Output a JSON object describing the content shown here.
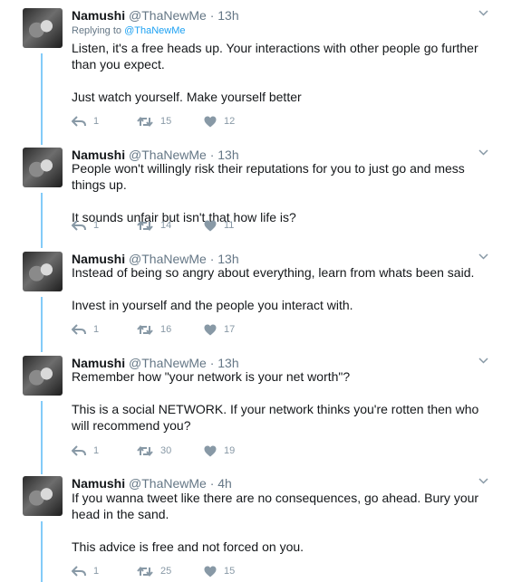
{
  "tweets": [
    {
      "name": "Namushi",
      "handle": "@ThaNewMe",
      "time": "13h",
      "reply_prefix": "Replying to",
      "reply_to": "@ThaNewMe",
      "p1": "Listen, it's a free heads up. Your interactions with other people go further than you expect.",
      "p2": "Just watch yourself. Make yourself better",
      "replies": "1",
      "retweets": "15",
      "likes": "12"
    },
    {
      "name": "Namushi",
      "handle": "@ThaNewMe",
      "time": "13h",
      "p1": "People won't willingly risk their reputations for you to just go and mess things up.",
      "p2": "It sounds unfair but isn't that how life is?",
      "replies": "1",
      "retweets": "14",
      "likes": "11"
    },
    {
      "name": "Namushi",
      "handle": "@ThaNewMe",
      "time": "13h",
      "p1": "Instead of being so angry about everything, learn from whats been said.",
      "p2": "Invest in yourself and the people you interact with.",
      "replies": "1",
      "retweets": "16",
      "likes": "17"
    },
    {
      "name": "Namushi",
      "handle": "@ThaNewMe",
      "time": "13h",
      "p1": "Remember how \"your network is your net worth\"?",
      "p2": "This is a social NETWORK. If your network thinks you're rotten then who will recommend you?",
      "replies": "1",
      "retweets": "30",
      "likes": "19"
    },
    {
      "name": "Namushi",
      "handle": "@ThaNewMe",
      "time": "4h",
      "p1": "If you wanna tweet like there are no consequences, go ahead. Bury your head in the sand.",
      "p2": "This advice is free and not forced on you.",
      "replies": "1",
      "retweets": "25",
      "likes": "15"
    }
  ],
  "icons": {
    "reply": "reply-icon",
    "retweet": "retweet-icon",
    "like": "heart-icon",
    "more": "chevron-down-icon"
  },
  "colors": {
    "link": "#1da1f2",
    "secondary": "#657786",
    "action": "#8899a6"
  }
}
